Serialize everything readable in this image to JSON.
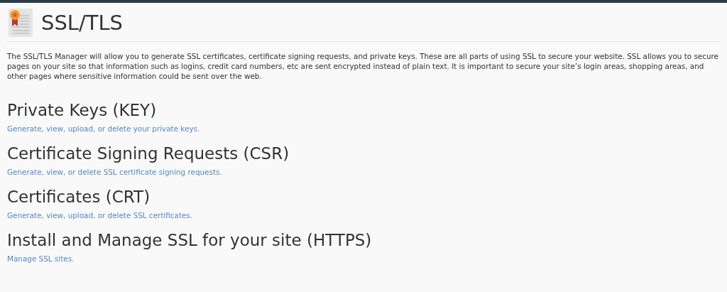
{
  "page": {
    "title": "SSL/TLS",
    "description": "The SSL/TLS Manager will allow you to generate SSL certificates, certificate signing requests, and private keys. These are all parts of using SSL to secure your website. SSL allows you to secure pages on your site so that information such as logins, credit card numbers, etc are sent encrypted instead of plain text. It is important to secure your site’s login areas, shopping areas, and other pages where sensitive information could be sent over the web."
  },
  "sections": [
    {
      "heading": "Private Keys (KEY)",
      "link": "Generate, view, upload, or delete your private keys."
    },
    {
      "heading": "Certificate Signing Requests (CSR)",
      "link": "Generate, view, or delete SSL certificate signing requests."
    },
    {
      "heading": "Certificates (CRT)",
      "link": "Generate, view, upload, or delete SSL certificates."
    },
    {
      "heading": "Install and Manage SSL for your site (HTTPS)",
      "link": "Manage SSL sites."
    }
  ]
}
